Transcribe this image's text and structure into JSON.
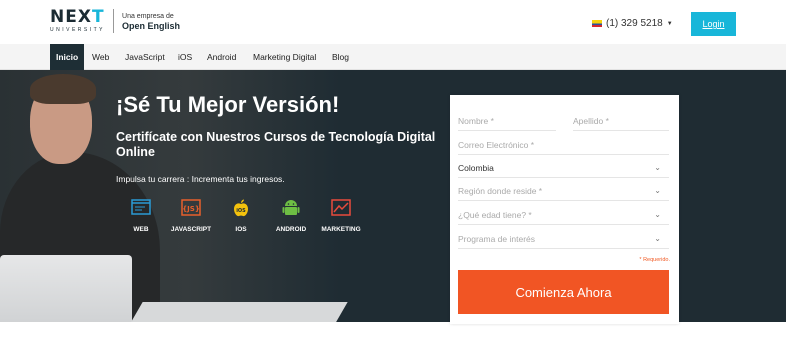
{
  "header": {
    "logo_main": "NEX",
    "logo_accent": "T",
    "logo_university": "UNIVERSITY",
    "logo_sub_line1": "Una empresa de",
    "logo_sub_line2": "Open English",
    "phone": "(1) 329 5218",
    "login_label": "Login"
  },
  "nav": {
    "items": [
      "Inicio",
      "Web",
      "JavaScript",
      "iOS",
      "Android",
      "Marketing Digital",
      "Blog"
    ]
  },
  "hero": {
    "title": "¡Sé Tu Mejor Versión!",
    "subtitle": "Certifícate con Nuestros Cursos de Tecnología Digital Online",
    "tagline": "Impulsa tu carrera : Incrementa tus ingresos.",
    "courses": [
      {
        "label": "WEB",
        "icon": "web-icon",
        "color": "#2a9bd6"
      },
      {
        "label": "JAVASCRIPT",
        "icon": "javascript-icon",
        "color": "#e8602c"
      },
      {
        "label": "IOS",
        "icon": "apple-icon",
        "color": "#f4c20d"
      },
      {
        "label": "ANDROID",
        "icon": "android-icon",
        "color": "#6ebe44"
      },
      {
        "label": "MARKETING",
        "icon": "marketing-icon",
        "color": "#e94b3c"
      }
    ]
  },
  "form": {
    "nombre_placeholder": "Nombre *",
    "apellido_placeholder": "Apellido *",
    "email_placeholder": "Correo Electrónico *",
    "country_value": "Colombia",
    "region_placeholder": "Región donde reside *",
    "age_placeholder": "¿Qué edad tiene? *",
    "program_placeholder": "Programa de interés",
    "required_note": "* Requerido.",
    "submit_label": "Comienza Ahora"
  },
  "colors": {
    "brand_cyan": "#18b6d9",
    "hero_bg": "#1f2c33",
    "cta_orange": "#f15524"
  }
}
